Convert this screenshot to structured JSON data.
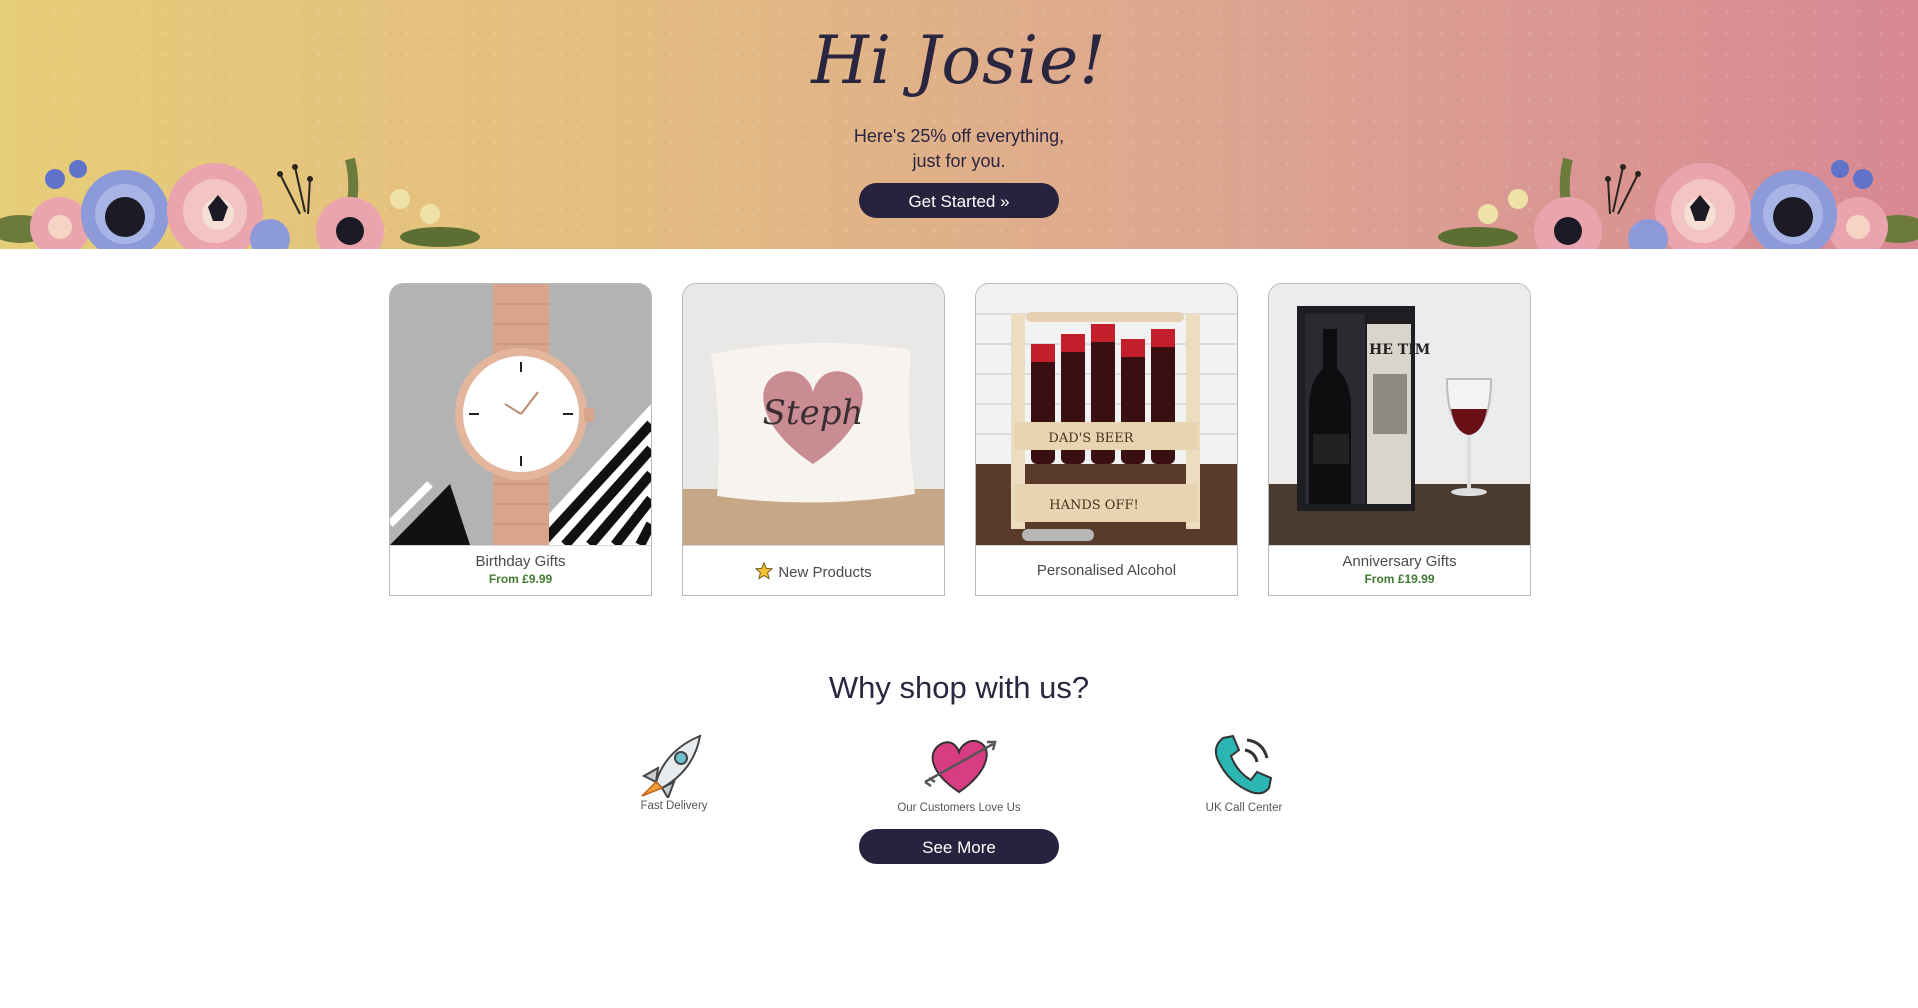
{
  "hero": {
    "greeting": "Hi Josie!",
    "subtext_line1": "Here's 25% off everything,",
    "subtext_line2": "just for you.",
    "cta_label": "Get Started »"
  },
  "categories": [
    {
      "title": "Birthday Gifts",
      "price": "From £9.99",
      "image": "rose-gold-watch"
    },
    {
      "title": "New Products",
      "price": "",
      "icon": "star-icon",
      "image": "personalised-heart-cushion"
    },
    {
      "title": "Personalised Alcohol",
      "price": "",
      "image": "dads-beer-crate"
    },
    {
      "title": "Anniversary Gifts",
      "price": "From £19.99",
      "image": "wine-and-newspaper-gift-box"
    }
  ],
  "why": {
    "title": "Why shop with us?",
    "features": [
      {
        "label": "Fast Delivery",
        "icon": "rocket-icon"
      },
      {
        "label": "Our Customers Love Us",
        "icon": "heart-arrow-icon"
      },
      {
        "label": "UK Call Center",
        "icon": "phone-icon"
      }
    ],
    "cta_label": "See More"
  },
  "colors": {
    "button_bg": "#27223d",
    "price_green": "#3f7a2f",
    "hero_gradient_start": "#e6cd78",
    "hero_gradient_end": "#d88893"
  }
}
